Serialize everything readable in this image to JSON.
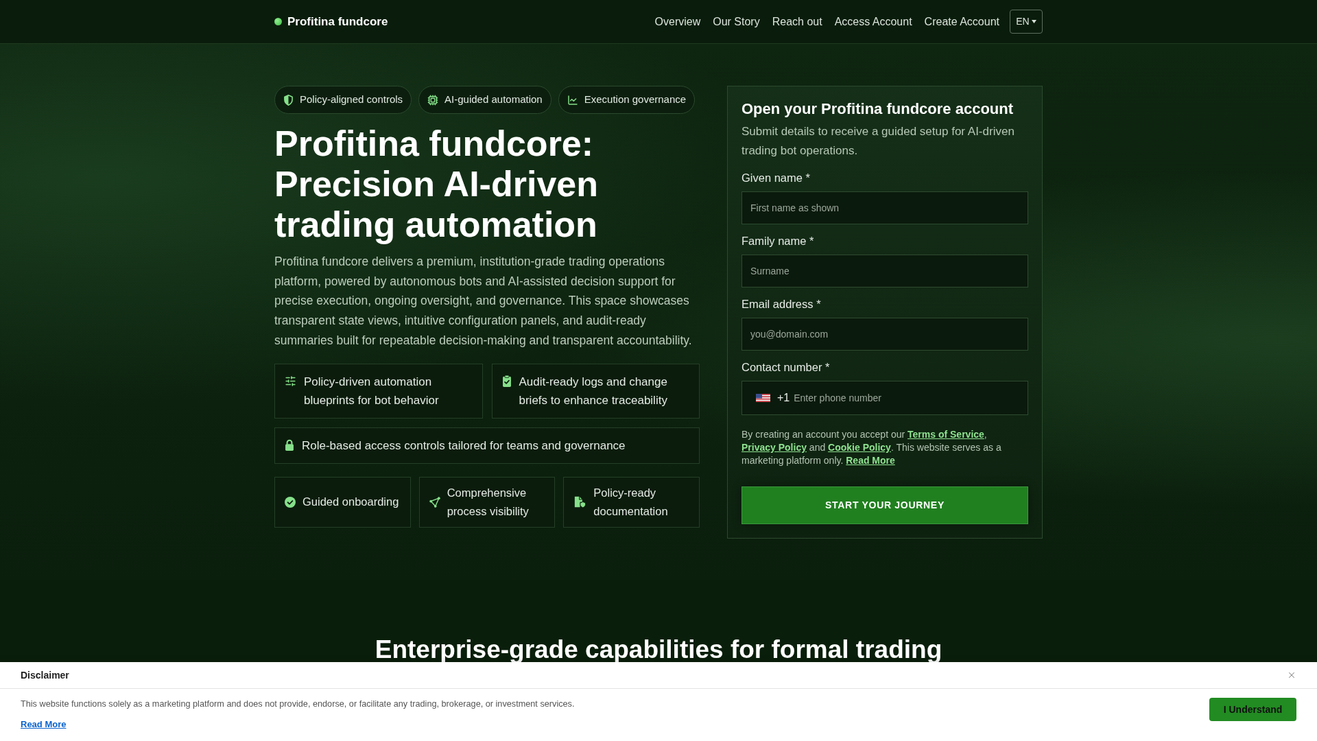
{
  "header": {
    "brand": "Profitina fundcore",
    "nav": [
      "Overview",
      "Our Story",
      "Reach out",
      "Access Account",
      "Create Account"
    ],
    "language": "EN"
  },
  "hero": {
    "pills": [
      "Policy-aligned controls",
      "AI-guided automation",
      "Execution governance"
    ],
    "title": "Profitina fundcore: Precision AI-driven trading automation",
    "description": "Profitina fundcore delivers a premium, institution-grade trading operations platform, powered by autonomous bots and AI-assisted decision support for precise execution, ongoing oversight, and governance. This space showcases transparent state views, intuitive configuration panels, and audit-ready summaries built for repeatable decision-making and transparent accountability.",
    "features": [
      "Policy-driven automation blueprints for bot behavior",
      "Audit-ready logs and change briefs to enhance traceability",
      "Role-based access controls tailored for teams and governance"
    ],
    "highlights": [
      "Guided onboarding",
      "Comprehensive process visibility",
      "Policy-ready documentation"
    ]
  },
  "signup_form": {
    "title": "Open your Profitina fundcore account",
    "subtitle": "Submit details to receive a guided setup for AI-driven trading bot operations.",
    "fields": [
      {
        "kind": "text",
        "label": "Given name *",
        "placeholder": "First name as shown"
      },
      {
        "kind": "text",
        "label": "Family name *",
        "placeholder": "Surname"
      },
      {
        "kind": "email",
        "label": "Email address *",
        "placeholder": "you@domain.com"
      },
      {
        "kind": "phone",
        "label": "Contact number *",
        "dial_code": "+1",
        "placeholder": "Enter phone number"
      }
    ],
    "consent": [
      {
        "kind": "text",
        "text": "By creating an account you accept our "
      },
      {
        "kind": "link",
        "text": "Terms of Service"
      },
      {
        "kind": "text",
        "text": ", "
      },
      {
        "kind": "link",
        "text": "Privacy Policy"
      },
      {
        "kind": "text",
        "text": " and "
      },
      {
        "kind": "link",
        "text": "Cookie Policy"
      },
      {
        "kind": "text",
        "text": ". This website serves as a marketing platform only. "
      },
      {
        "kind": "link",
        "text": "Read More"
      }
    ],
    "submit": "START YOUR JOURNEY"
  },
  "capabilities_section": {
    "title": "Enterprise-grade capabilities for formal trading"
  },
  "disclaimer": {
    "title": "Disclaimer",
    "text": "This website functions solely as a marketing platform and does not provide, endorse, or facilitate any trading, brokerage, or investment services.",
    "link": "Read More",
    "button": "I Understand"
  }
}
